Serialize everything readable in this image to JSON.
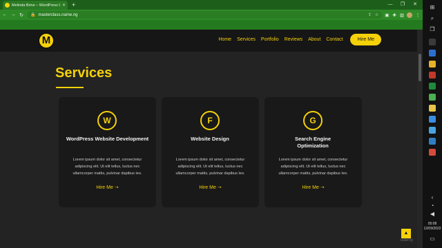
{
  "browser": {
    "tab_title": "Melinda Brine – WordPress Deve",
    "url": "masterclass.name.ng",
    "icons": [
      "back-icon",
      "forward-icon",
      "reload-icon",
      "lock-icon",
      "share-icon",
      "star-icon",
      "extension-icon",
      "puzzle-icon",
      "profile-icon",
      "menu-icon"
    ]
  },
  "site": {
    "logo_letter": "M",
    "nav": [
      "Home",
      "Services",
      "Portfolio",
      "Reviews",
      "About",
      "Contact"
    ],
    "hire_button": "Hire Me",
    "section_title": "Services",
    "cards": [
      {
        "icon": "wordpress-icon",
        "icon_glyph": "W",
        "title": "WordPress Website Development",
        "text": "Lorem ipsum dolor sit amet, consectetur adipiscing elit. Ut elit tellus, luctus nec ullamcorper mattis, pulvinar dapibus leo.",
        "link": "Hire Me  ➝"
      },
      {
        "icon": "figma-icon",
        "icon_glyph": "F",
        "title": "Website Design",
        "text": "Lorem ipsum dolor sit amet, consectetur adipiscing elit. Ut elit tellus, luctus nec ullamcorper mattis, pulvinar dapibus leo.",
        "link": "Hire Me  ➝"
      },
      {
        "icon": "google-icon",
        "icon_glyph": "G",
        "title": "Search Engine Optimization",
        "text": "Lorem ipsum dolor sit amet, consectetur adipiscing elit. Ut elit tellus, luctus nec ullamcorper mattis, pulvinar dapibus leo.",
        "link": "Hire Me  ➝"
      }
    ],
    "watermark": "udemy"
  },
  "taskbar": {
    "time": "05:08",
    "date": "12/09/2022"
  },
  "colors": {
    "accent": "#f5d10a",
    "browser_green": "#2e8a27",
    "site_bg": "#232323",
    "card_bg": "#191919"
  }
}
